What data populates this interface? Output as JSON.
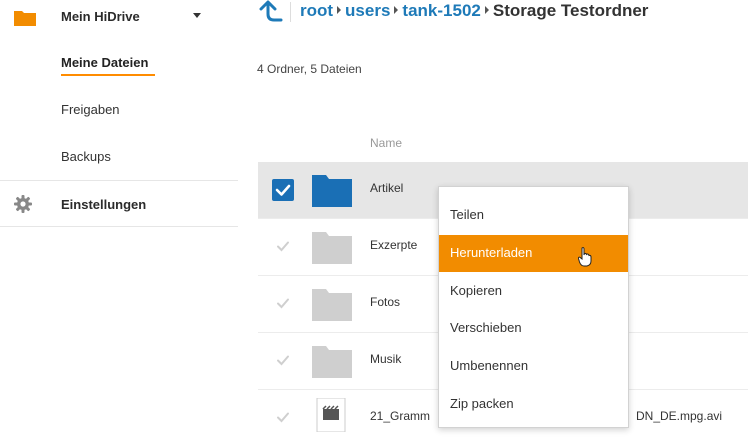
{
  "sidebar": {
    "title": "Mein HiDrive",
    "items": [
      {
        "label": "Meine Dateien",
        "active": true
      },
      {
        "label": "Freigaben"
      },
      {
        "label": "Backups"
      }
    ],
    "settings_label": "Einstellungen"
  },
  "breadcrumb": {
    "parts": [
      "root",
      "users",
      "tank-1502"
    ],
    "current": "Storage Testordner"
  },
  "summary": "4 Ordner, 5 Dateien",
  "table": {
    "column_name": "Name",
    "rows": [
      {
        "name": "Artikel",
        "type": "folder",
        "selected": true
      },
      {
        "name": "Exzerpte",
        "type": "folder"
      },
      {
        "name": "Fotos",
        "type": "folder"
      },
      {
        "name": "Musik",
        "type": "folder"
      },
      {
        "name": "21_Gramm",
        "tail": "DN_DE.mpg.avi",
        "type": "video"
      }
    ]
  },
  "context_menu": {
    "items": [
      "Teilen",
      "Herunterladen",
      "Kopieren",
      "Verschieben",
      "Umbenennen",
      "Zip packen"
    ],
    "highlighted_index": 1
  },
  "colors": {
    "accent_orange": "#f28c00",
    "link_blue": "#1e7ab8",
    "folder_blue": "#1a6fb5",
    "folder_gray": "#cfcfcf"
  }
}
